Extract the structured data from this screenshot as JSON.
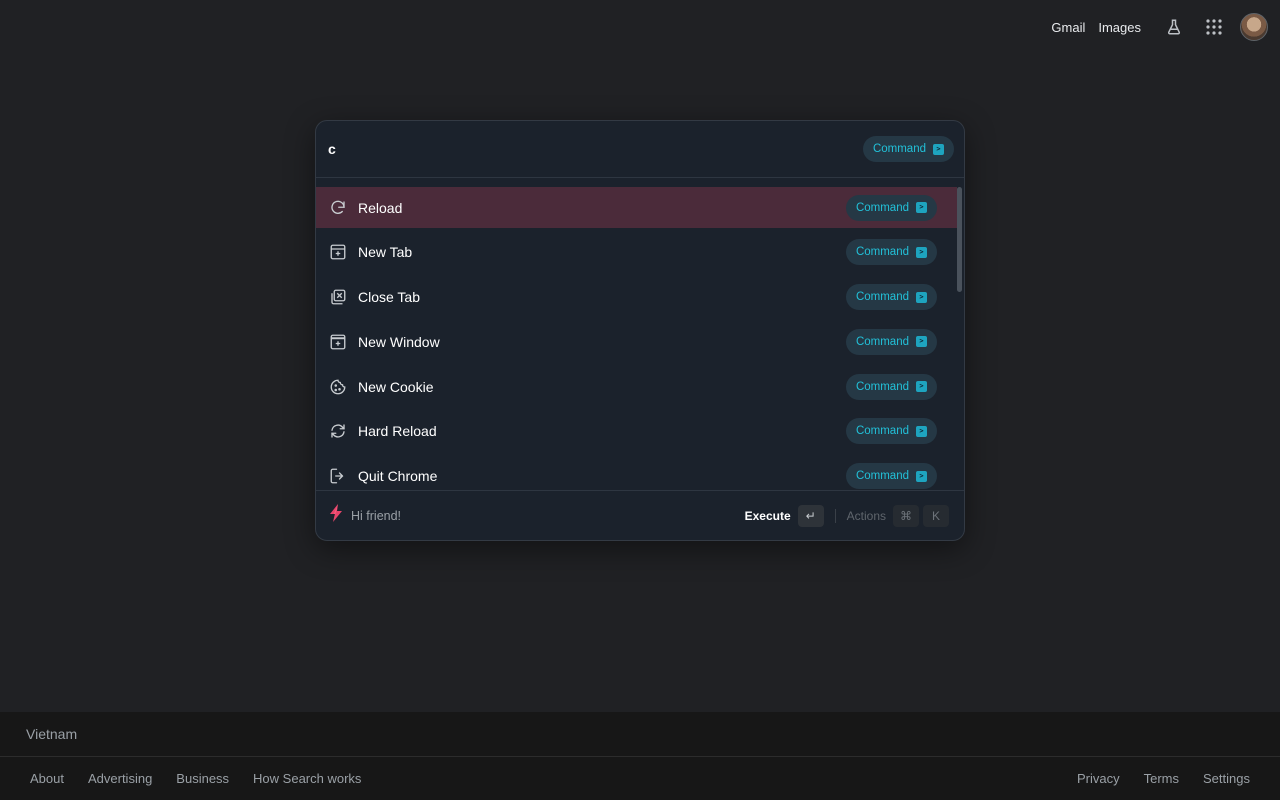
{
  "header": {
    "links": [
      "Gmail",
      "Images"
    ],
    "icons": [
      "labs-flask-icon",
      "apps-grid-icon"
    ],
    "avatar": "account-avatar"
  },
  "palette": {
    "query": "c",
    "mode_badge": "Command",
    "items": [
      {
        "label": "Reload",
        "icon": "reload-icon",
        "badge": "Command",
        "active": true
      },
      {
        "label": "New Tab",
        "icon": "new-tab-icon",
        "badge": "Command",
        "active": false
      },
      {
        "label": "Close Tab",
        "icon": "close-tab-icon",
        "badge": "Command",
        "active": false
      },
      {
        "label": "New Window",
        "icon": "new-window-icon",
        "badge": "Command",
        "active": false
      },
      {
        "label": "New Cookie",
        "icon": "cookie-icon",
        "badge": "Command",
        "active": false
      },
      {
        "label": "Hard Reload",
        "icon": "hard-reload-icon",
        "badge": "Command",
        "active": false
      },
      {
        "label": "Quit Chrome",
        "icon": "quit-icon",
        "badge": "Command",
        "active": false
      }
    ],
    "footer": {
      "greeting": "Hi friend!",
      "execute_label": "Execute",
      "execute_key": "↵",
      "actions_label": "Actions",
      "actions_keys": [
        "⌘",
        "K"
      ]
    }
  },
  "footer": {
    "country": "Vietnam",
    "left_links": [
      "About",
      "Advertising",
      "Business",
      "How Search works"
    ],
    "right_links": [
      "Privacy",
      "Terms",
      "Settings"
    ]
  },
  "colors": {
    "page_bg": "#202124",
    "palette_bg": "#1b222c",
    "active_row": "#4b2b3a",
    "badge_bg": "#253845",
    "badge_text": "#22c0d8",
    "accent_bolt": "#e8456b"
  }
}
